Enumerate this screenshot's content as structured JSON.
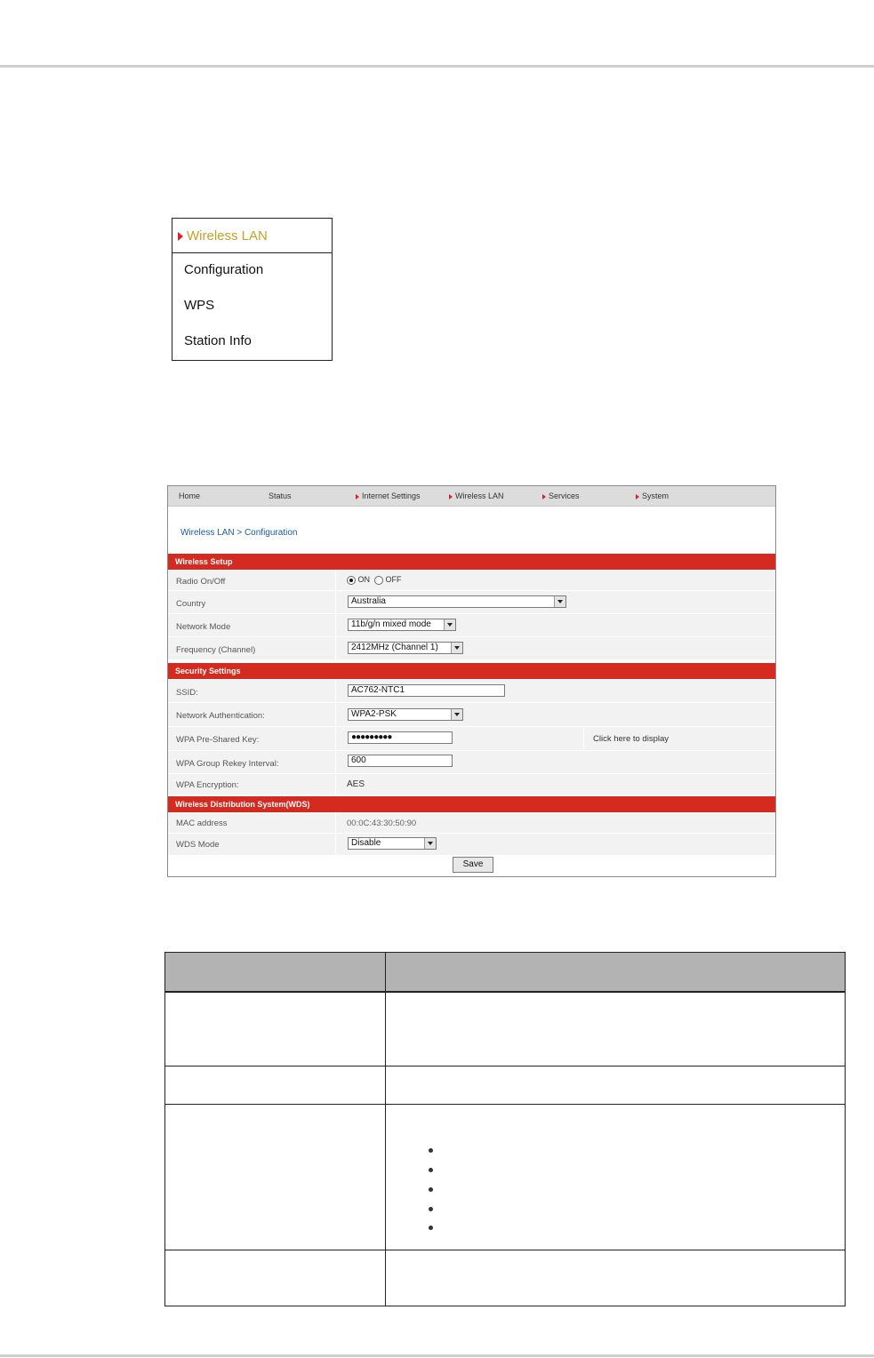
{
  "menu": {
    "title": "Wireless LAN",
    "items": [
      "Configuration",
      "WPS",
      "Station Info"
    ]
  },
  "router_ui": {
    "nav": [
      "Home",
      "Status",
      "Internet Settings",
      "Wireless LAN",
      "Services",
      "System"
    ],
    "breadcrumb": "Wireless LAN > Configuration",
    "sections": {
      "wireless_setup": "Wireless Setup",
      "security": "Security Settings",
      "wds": "Wireless Distribution System(WDS)"
    },
    "labels": {
      "radio": "Radio On/Off",
      "country": "Country",
      "network_mode": "Network Mode",
      "frequency": "Frequency (Channel)",
      "ssid": "SSID:",
      "auth": "Network Authentication:",
      "psk": "WPA Pre-Shared Key:",
      "rekey": "WPA Group Rekey Interval:",
      "encryption": "WPA Encryption:",
      "mac": "MAC address",
      "wds_mode": "WDS Mode"
    },
    "values": {
      "radio_on": "ON",
      "radio_off": "OFF",
      "country": "Australia",
      "network_mode": "11b/g/n mixed mode",
      "frequency": "2412MHz (Channel 1)",
      "ssid": "AC762-NTC1",
      "auth": "WPA2-PSK",
      "psk": "●●●●●●●●●",
      "psk_link": "Click here to display",
      "rekey": "600",
      "encryption": "AES",
      "mac": "00:0C:43:30:50:90",
      "wds_mode": "Disable"
    },
    "save": "Save"
  }
}
